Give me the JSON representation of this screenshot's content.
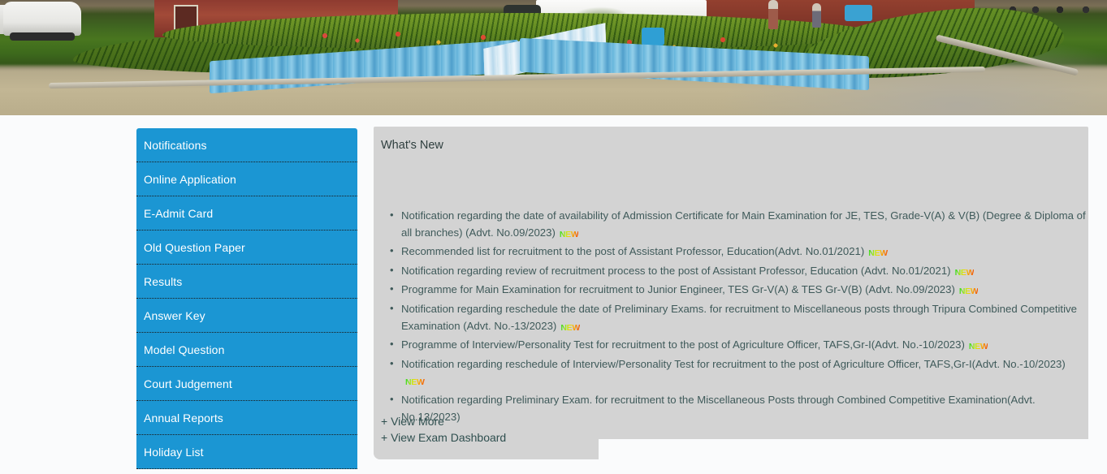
{
  "banner": {
    "alt": "TPSC office garden banner photograph"
  },
  "sidebar": {
    "items": [
      {
        "label": "Notifications"
      },
      {
        "label": "Online Application"
      },
      {
        "label": "E-Admit Card"
      },
      {
        "label": "Old Question Paper"
      },
      {
        "label": "Results"
      },
      {
        "label": "Answer Key"
      },
      {
        "label": "Model Question"
      },
      {
        "label": "Court Judgement"
      },
      {
        "label": "Annual Reports"
      },
      {
        "label": "Holiday List"
      }
    ]
  },
  "whats_new": {
    "title": "What's New",
    "badge_text": "NEW",
    "items": [
      {
        "text": "Notification regarding the date of availability of Admission Certificate for Main Examination for JE, TES, Grade-V(A) & V(B) (Degree & Diploma of all branches) (Advt. No.09/2023)",
        "new": true
      },
      {
        "text": "Recommended list for recruitment to the post of Assistant Professor, Education(Advt. No.01/2021)",
        "new": true
      },
      {
        "text": "Notification regarding review of recruitment process to the post of Assistant Professor, Education (Advt. No.01/2021)",
        "new": true
      },
      {
        "text": "Programme for Main Examination for recruitment to Junior Engineer, TES Gr-V(A) & TES Gr-V(B) (Advt. No.09/2023)",
        "new": true
      },
      {
        "text": "Notification regarding reschedule the date of Preliminary Exams. for recruitment to Miscellaneous posts through Tripura Combined Competitive Examination (Advt. No.-13/2023)",
        "new": true
      },
      {
        "text": "Programme of Interview/Personality Test for recruitment to the post of Agriculture Officer, TAFS,Gr-I(Advt. No.-10/2023)",
        "new": true
      },
      {
        "text": "Notification regarding reschedule of Interview/Personality Test for recruitment to the post of Agriculture Officer, TAFS,Gr-I(Advt. No.-10/2023)",
        "new": true
      },
      {
        "text": "Notification regarding Preliminary Exam. for recruitment to the Miscellaneous Posts through Combined Competitive Examination(Advt. No.13/2023)",
        "new": false
      }
    ],
    "links": [
      {
        "label": "+ View More"
      },
      {
        "label": "+ View Exam Dashboard"
      }
    ]
  },
  "colors": {
    "sidebar_blue": "#1b96d3",
    "panel_gray": "#d3d3d3",
    "page_bg": "#fafbfc",
    "list_text": "#3f5a5a",
    "title_text": "#2f3f3f"
  }
}
